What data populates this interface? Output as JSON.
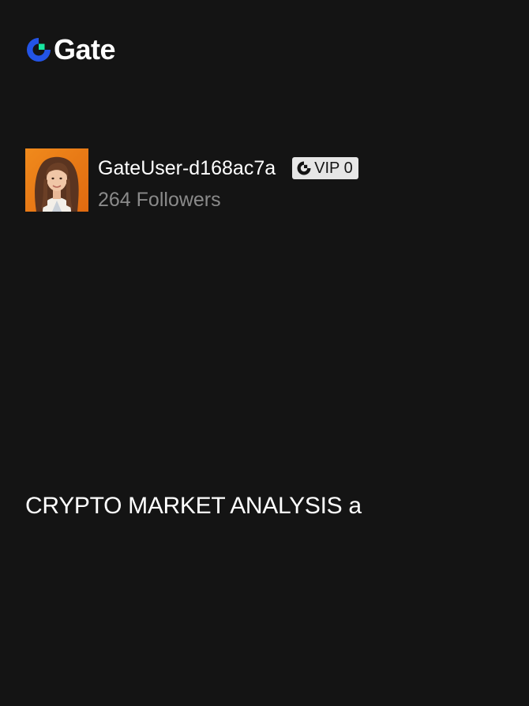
{
  "brand": {
    "name": "Gate",
    "logo_icon": "gate-logo-icon",
    "colors": {
      "primary_blue": "#2354E6",
      "accent_green": "#17E6A1"
    }
  },
  "profile": {
    "avatar_icon": "user-avatar",
    "username": "GateUser-d168ac7a",
    "vip_badge": {
      "icon": "gate-logo-icon",
      "label": "VIP 0"
    },
    "followers": "264 Followers"
  },
  "post": {
    "title": "CRYPTO MARKET ANALYSIS a"
  },
  "theme": {
    "background": "#141414",
    "text_primary": "#FFFFFF",
    "text_secondary": "#8A8A8A",
    "badge_bg": "#E6E6E6"
  }
}
